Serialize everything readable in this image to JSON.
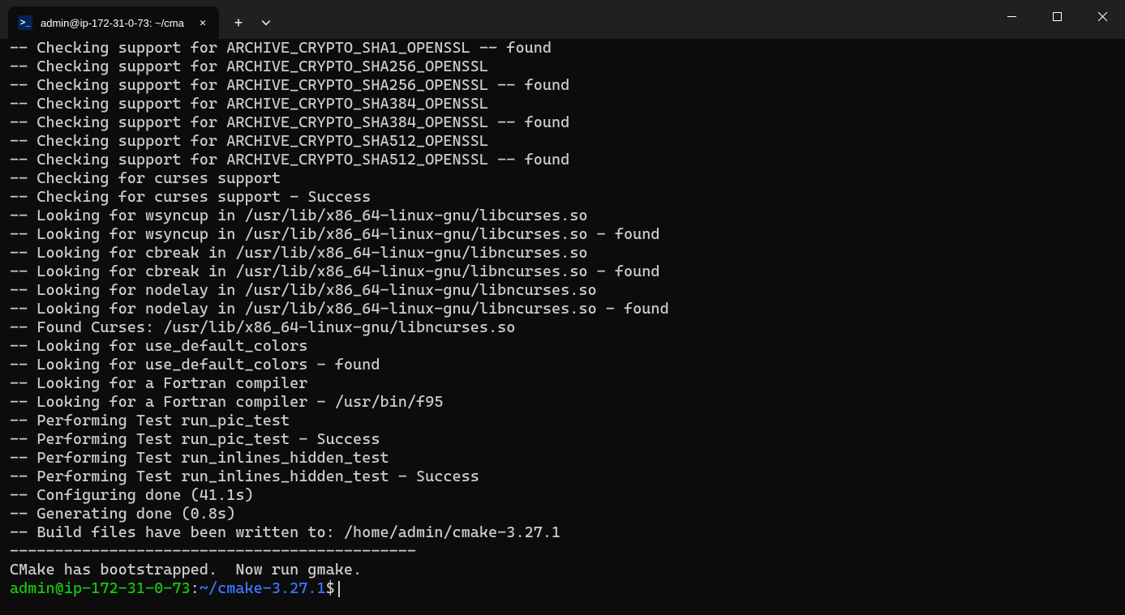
{
  "tab": {
    "title": "admin@ip-172-31-0-73: ~/cma",
    "icon_glyph": ">_"
  },
  "output_lines": [
    "-- Checking support for ARCHIVE_CRYPTO_SHA1_OPENSSL -- found",
    "-- Checking support for ARCHIVE_CRYPTO_SHA256_OPENSSL",
    "-- Checking support for ARCHIVE_CRYPTO_SHA256_OPENSSL -- found",
    "-- Checking support for ARCHIVE_CRYPTO_SHA384_OPENSSL",
    "-- Checking support for ARCHIVE_CRYPTO_SHA384_OPENSSL -- found",
    "-- Checking support for ARCHIVE_CRYPTO_SHA512_OPENSSL",
    "-- Checking support for ARCHIVE_CRYPTO_SHA512_OPENSSL -- found",
    "-- Checking for curses support",
    "-- Checking for curses support - Success",
    "-- Looking for wsyncup in /usr/lib/x86_64-linux-gnu/libcurses.so",
    "-- Looking for wsyncup in /usr/lib/x86_64-linux-gnu/libcurses.so - found",
    "-- Looking for cbreak in /usr/lib/x86_64-linux-gnu/libncurses.so",
    "-- Looking for cbreak in /usr/lib/x86_64-linux-gnu/libncurses.so - found",
    "-- Looking for nodelay in /usr/lib/x86_64-linux-gnu/libncurses.so",
    "-- Looking for nodelay in /usr/lib/x86_64-linux-gnu/libncurses.so - found",
    "-- Found Curses: /usr/lib/x86_64-linux-gnu/libncurses.so",
    "-- Looking for use_default_colors",
    "-- Looking for use_default_colors - found",
    "-- Looking for a Fortran compiler",
    "-- Looking for a Fortran compiler - /usr/bin/f95",
    "-- Performing Test run_pic_test",
    "-- Performing Test run_pic_test - Success",
    "-- Performing Test run_inlines_hidden_test",
    "-- Performing Test run_inlines_hidden_test - Success",
    "-- Configuring done (41.1s)",
    "-- Generating done (0.8s)",
    "-- Build files have been written to: /home/admin/cmake-3.27.1",
    "---------------------------------------------",
    "CMake has bootstrapped.  Now run gmake."
  ],
  "prompt": {
    "user_host": "admin@ip-172-31-0-73",
    "separator": ":",
    "path": "~/cmake-3.27.1",
    "symbol": "$"
  }
}
